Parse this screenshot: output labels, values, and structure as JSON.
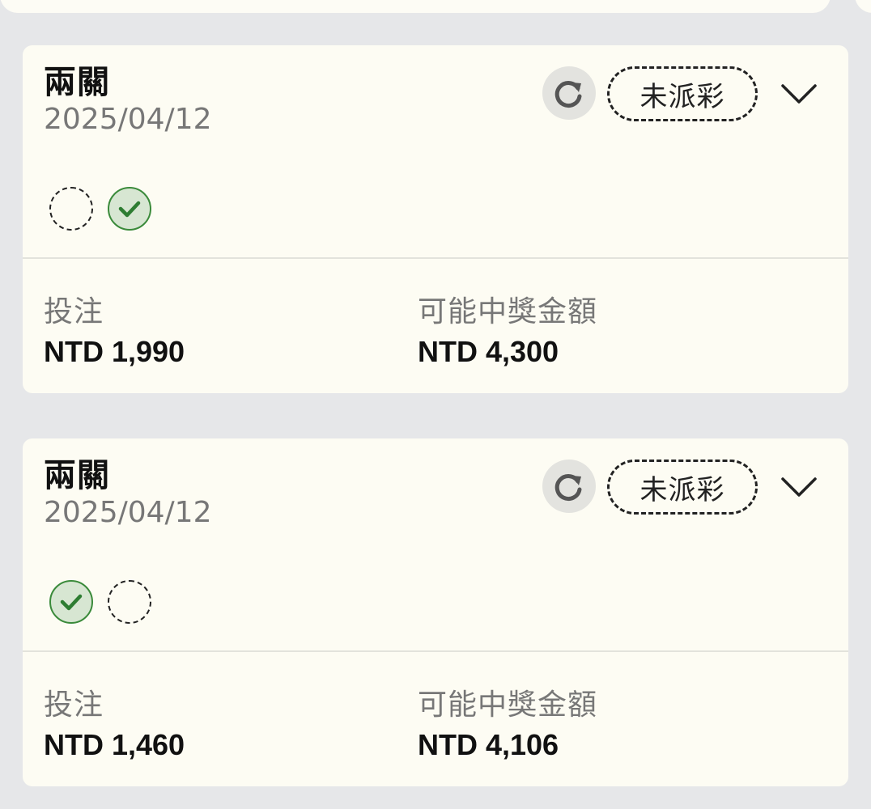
{
  "bets": [
    {
      "type": "兩關",
      "date": "2025/04/12",
      "status": "未派彩",
      "legs": [
        "pending",
        "won"
      ],
      "stake_label": "投注",
      "stake_value": "NTD 1,990",
      "payout_label": "可能中獎金額",
      "payout_value": "NTD 4,300"
    },
    {
      "type": "兩關",
      "date": "2025/04/12",
      "status": "未派彩",
      "legs": [
        "won",
        "pending"
      ],
      "stake_label": "投注",
      "stake_value": "NTD 1,460",
      "payout_label": "可能中獎金額",
      "payout_value": "NTD 4,106"
    }
  ],
  "icons": {
    "refresh": "refresh-icon",
    "expand": "chevron-down-icon",
    "leg_won": "check-circle-icon",
    "leg_pending": "dashed-circle-icon"
  },
  "colors": {
    "card_bg": "#fdfcf3",
    "page_bg": "#e6e7e9",
    "won_green": "#2e7d32"
  }
}
